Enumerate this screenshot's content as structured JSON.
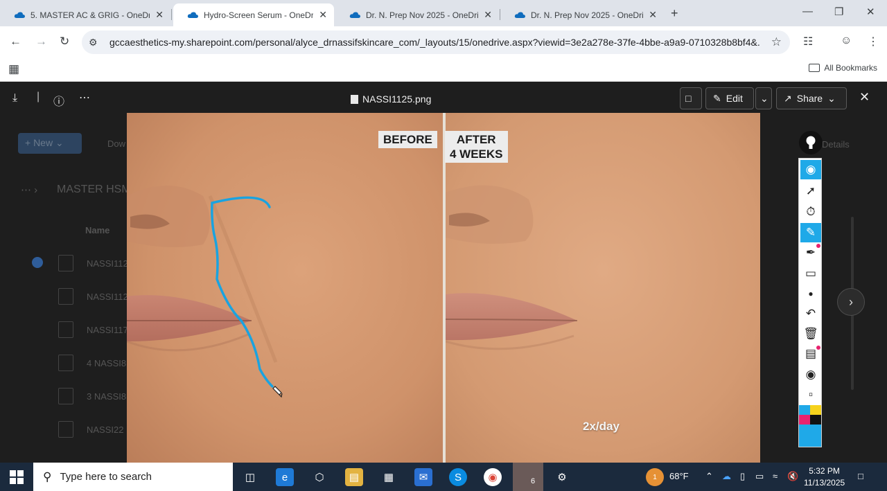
{
  "browser": {
    "tabs": [
      {
        "label": "5. MASTER AC & GRIG - OneDr",
        "active": false
      },
      {
        "label": "Hydro-Screen Serum - OneDriv",
        "active": true
      },
      {
        "label": "Dr. N. Prep Nov 2025 - OneDriv",
        "active": false
      },
      {
        "label": "Dr. N. Prep Nov 2025 - OneDriv",
        "active": false
      }
    ],
    "tab_close_glyph": "✕",
    "new_tab_glyph": "+",
    "url": "gccaesthetics-my.sharepoint.com/personal/alyce_drnassifskincare_com/_layouts/15/onedrive.aspx?viewid=3e2a278e-37fe-4bbe-a9a9-0710328b8bf4&...",
    "bookmarks_label": "All Bookmarks"
  },
  "background_page": {
    "new_label": "+ New ⌄",
    "download_label": "Dow",
    "breadcrumb": "MASTER HSM",
    "name_header": "Name",
    "details_label": "Details",
    "files": [
      "NASSI112",
      "NASSI112",
      "NASSI117",
      "4 NASSI8",
      "3 NASSI8",
      "NASSI22"
    ]
  },
  "viewer": {
    "file_name": "NASSI1125.png",
    "edit_label": "Edit",
    "share_label": "Share",
    "image": {
      "before_label": "BEFORE",
      "after_label_line1": "AFTER",
      "after_label_line2": "4 WEEKS",
      "frequency": "2x/day"
    }
  },
  "annotation_tools": [
    "eye-icon",
    "cursor-icon",
    "stopwatch-icon",
    "highlighter-icon",
    "pen-icon",
    "eraser-icon",
    "dot-icon",
    "undo-icon",
    "trash-icon",
    "whiteboard-icon",
    "camera-icon",
    "clipboard-icon"
  ],
  "annotation_colors": [
    "#1fa9e8",
    "#f6d21c",
    "#e8226e",
    "#111111",
    "#1fa9e8"
  ],
  "taskbar": {
    "search_placeholder": "Type here to search",
    "badge_count": "6",
    "weather_badge": "1",
    "temperature": "68°F",
    "time": "5:32 PM",
    "date": "11/13/2025"
  }
}
